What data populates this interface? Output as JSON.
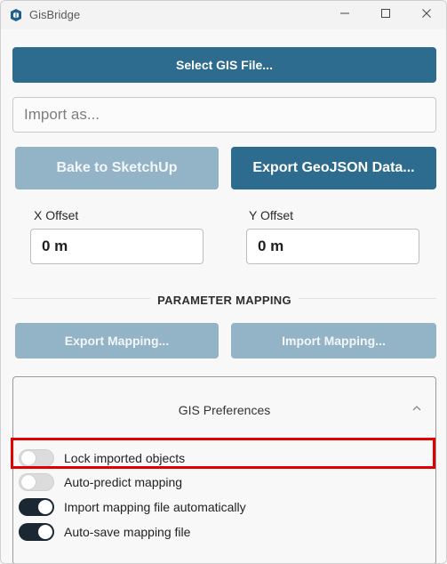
{
  "window": {
    "title": "GisBridge",
    "icons": {
      "app": "sketchup-logo-icon",
      "minimize": "minimize-icon",
      "maximize": "maximize-icon",
      "close": "close-icon"
    }
  },
  "buttons": {
    "select_gis_file": "Select GIS File...",
    "bake_to_sketchup": "Bake to SketchUp",
    "export_geojson": "Export GeoJSON Data...",
    "export_mapping": "Export Mapping...",
    "import_mapping": "Import Mapping..."
  },
  "import_as": {
    "placeholder": "Import as..."
  },
  "offsets": {
    "x_label": "X Offset",
    "x_value": "0 m",
    "y_label": "Y Offset",
    "y_value": "0 m"
  },
  "parameter_mapping": {
    "heading": "PARAMETER MAPPING"
  },
  "preferences": {
    "title": "GIS Preferences",
    "expanded": true,
    "toggles": [
      {
        "label": "Lock imported objects",
        "on": false
      },
      {
        "label": "Auto-predict mapping",
        "on": false
      },
      {
        "label": "Import mapping file automatically",
        "on": true
      },
      {
        "label": "Auto-save mapping file",
        "on": true
      }
    ]
  },
  "colors": {
    "primary_button": "#2d6b8f",
    "disabled_button": "#93b3c7",
    "toggle_on": "#1b2733",
    "highlight": "#e00000"
  }
}
